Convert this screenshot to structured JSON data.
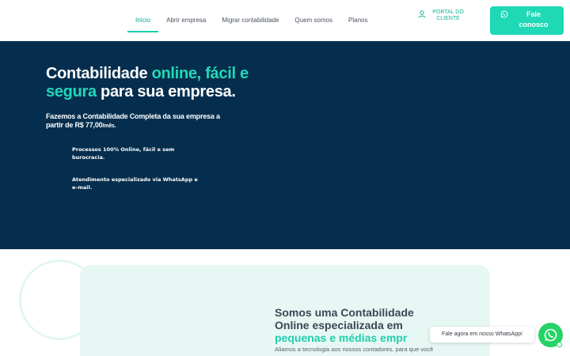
{
  "nav": {
    "items": [
      {
        "label": "Início",
        "active": true
      },
      {
        "label": "Abrir empresa",
        "active": false
      },
      {
        "label": "Migrar contabilidade",
        "active": false
      },
      {
        "label": "Quem somos",
        "active": false
      },
      {
        "label": "Planos",
        "active": false
      }
    ],
    "portal_label": "PORTAL DO CLIENTE",
    "cta_label": "Fale conosco"
  },
  "hero": {
    "title_part1": "Contabilidade ",
    "title_highlight1": "online, fácil e segura",
    "title_part2": " para sua empresa.",
    "subtitle_main": "Fazemos a Contabilidade Completa da sua empresa a partir de R$ 77,00",
    "subtitle_small": "/mês.",
    "features": [
      "Processos 100% Online, fácil e sem burocracia.",
      "Atendimento especializado via WhatsApp e e-mail."
    ]
  },
  "about": {
    "title_line": "Somos uma Contabilidade Online especializada em ",
    "title_highlight": "pequenas e médias empr",
    "text": "Aliamos a tecnologia aos nossos contadores, para que você"
  },
  "whatsapp": {
    "tooltip": "Fale agora em nosso WhatsApp!"
  },
  "colors": {
    "accent": "#1ed8b6",
    "hero_bg": "#052e4e",
    "whatsapp": "#25d366"
  }
}
